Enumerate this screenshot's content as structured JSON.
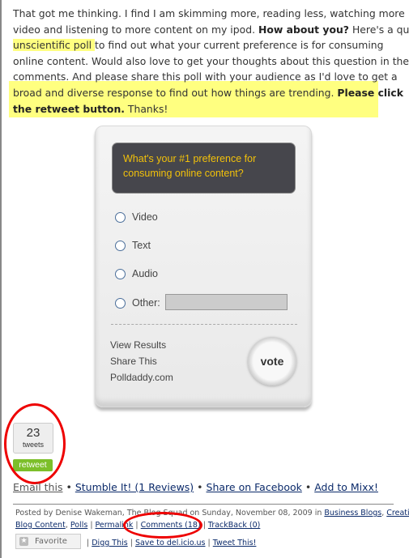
{
  "article": {
    "lines": [
      [
        "That got me thinking. I find I am skimming more, reading less, watching more"
      ],
      [
        "video and listening to more content on my ipod. ",
        "How about you?",
        " Here's a quick"
      ],
      [
        "unscientific poll ",
        "to find out what your current preference is for consuming"
      ],
      [
        "online content. Would also love to get your thoughts about this question in the"
      ],
      [
        "comments. And please share this poll with your audience as I'd love to get a"
      ],
      [
        "broad and diverse response to find out how things are trending. ",
        "Please click"
      ],
      [
        "the retweet button.",
        " Thanks!"
      ]
    ]
  },
  "poll": {
    "question": "What's your #1 preference for consuming online content?",
    "options": [
      "Video",
      "Text",
      "Audio",
      "Other:"
    ],
    "other_value": "",
    "links": [
      "View Results",
      "Share This",
      "Polldaddy.com"
    ],
    "vote_label": "vote",
    "question_color": "#f2c10a"
  },
  "tweetmeme": {
    "count": "23",
    "unit": "tweets",
    "button": "retweet"
  },
  "share": {
    "email": "Email this",
    "stumble": "Stumble It! (1 Reviews)",
    "facebook": "Share on Facebook",
    "mixx": "Add to Mixx!",
    "sep": "•"
  },
  "meta": {
    "posted": "Posted by Denise Wakeman, The Blog Squad on Sunday, November 08, 2009 in ",
    "cat1": "Business Blogs",
    "cat2a": "Creating",
    "cat2b": "Blog Content",
    "cat3": "Polls",
    "permalink": "Permalink",
    "comments": "Comments (18)",
    "trackback": "TrackBack (0)",
    "favorite": "Favorite",
    "digg": "Digg This",
    "delicious": "Save to del.icio.us",
    "tweet": "Tweet This!"
  },
  "annotation_color": "#ee0000"
}
